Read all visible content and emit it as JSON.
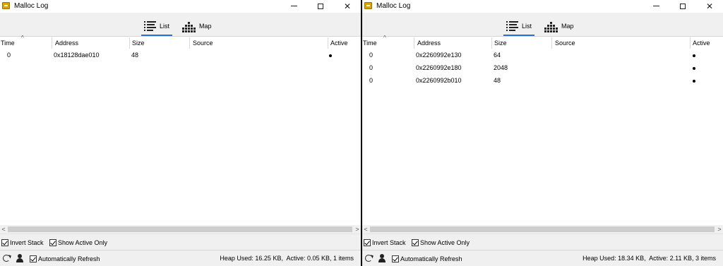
{
  "windows": [
    {
      "title": "Malloc Log",
      "tabs": [
        {
          "label": "List",
          "active": true
        },
        {
          "label": "Map",
          "active": false
        }
      ],
      "columns": [
        "Time",
        "Address",
        "Size",
        "Source",
        "Active"
      ],
      "rows": [
        {
          "time": "0",
          "address": "0x18128dae010",
          "size": "48",
          "source": "",
          "active": true
        }
      ],
      "options": {
        "invert_stack": "Invert Stack",
        "show_active_only": "Show Active Only",
        "auto_refresh": "Automatically Refresh"
      },
      "status": "Heap Used: 16.25 KB,  Active: 0.05 KB, 1 items"
    },
    {
      "title": "Malloc Log",
      "tabs": [
        {
          "label": "List",
          "active": true
        },
        {
          "label": "Map",
          "active": false
        }
      ],
      "columns": [
        "Time",
        "Address",
        "Size",
        "Source",
        "Active"
      ],
      "rows": [
        {
          "time": "0",
          "address": "0x2260992e130",
          "size": "64",
          "source": "",
          "active": true
        },
        {
          "time": "0",
          "address": "0x2260992e180",
          "size": "2048",
          "source": "",
          "active": true
        },
        {
          "time": "0",
          "address": "0x2260992b010",
          "size": "48",
          "source": "",
          "active": true
        }
      ],
      "options": {
        "invert_stack": "Invert Stack",
        "show_active_only": "Show Active Only",
        "auto_refresh": "Automatically Refresh"
      },
      "status": "Heap Used: 18.34 KB,  Active: 2.11 KB, 3 items"
    }
  ],
  "colors": {
    "accent": "#2a6fd1",
    "app_icon": "#d9a400",
    "toolbar_bg": "#f0f0f0"
  },
  "icons": {
    "app": "malloc-app-icon",
    "list": "list-icon",
    "map": "map-icon",
    "refresh": "refresh-icon",
    "user": "user-icon"
  }
}
